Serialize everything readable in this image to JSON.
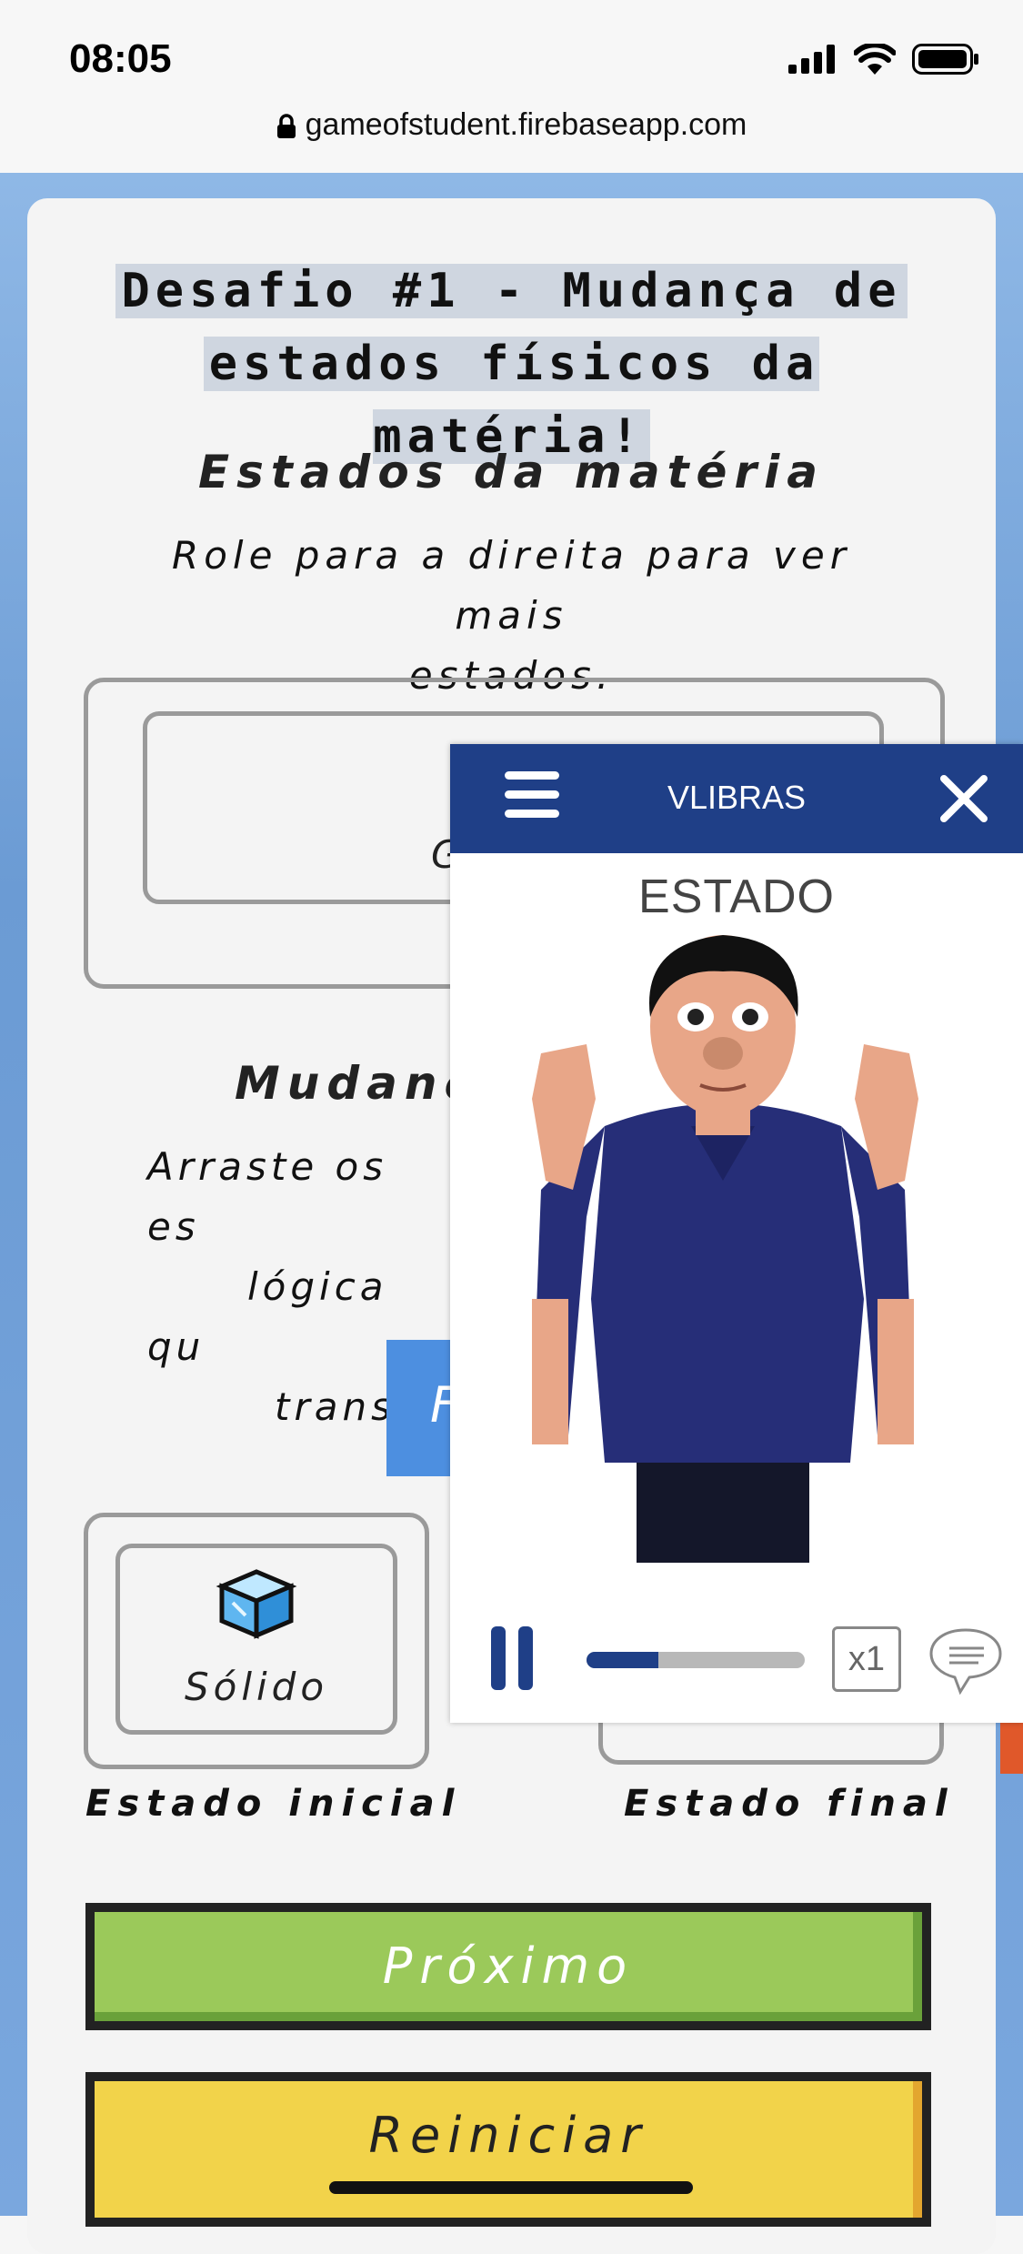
{
  "status_bar": {
    "time": "08:05"
  },
  "url_bar": {
    "url": "gameofstudent.firebaseapp.com"
  },
  "challenge": {
    "title_line1": "Desafio #1 - Mudança de",
    "title_line2": "estados físicos da matéria!",
    "states_heading": "Estados da matéria",
    "states_hint_line1": "Role para a direita para ver mais",
    "states_hint_line2": "estados.",
    "carousel_partial_text": "G",
    "changes_heading_partial": "Mudanç",
    "drag_hint_line1_partial": "Arraste os es",
    "drag_hint_line2_partial": "lógica qu",
    "drag_hint_line3_partial": "transfor",
    "blue_button_partial": "F",
    "initial_state_item": "Sólido",
    "initial_state_label": "Estado inicial",
    "final_state_label": "Estado final"
  },
  "buttons": {
    "next": "Próximo",
    "reset": "Reiniciar"
  },
  "vlibras": {
    "title": "VLIBRAS",
    "current_word": "ESTADO",
    "speed": "x1",
    "progress": 0.33,
    "colors": {
      "header": "#1f3f87"
    }
  },
  "icons": [
    "lock-icon",
    "signal-icon",
    "wifi-icon",
    "battery-icon",
    "ice-cube-icon",
    "menu-icon",
    "close-icon",
    "pause-icon",
    "chat-bubble-icon"
  ]
}
